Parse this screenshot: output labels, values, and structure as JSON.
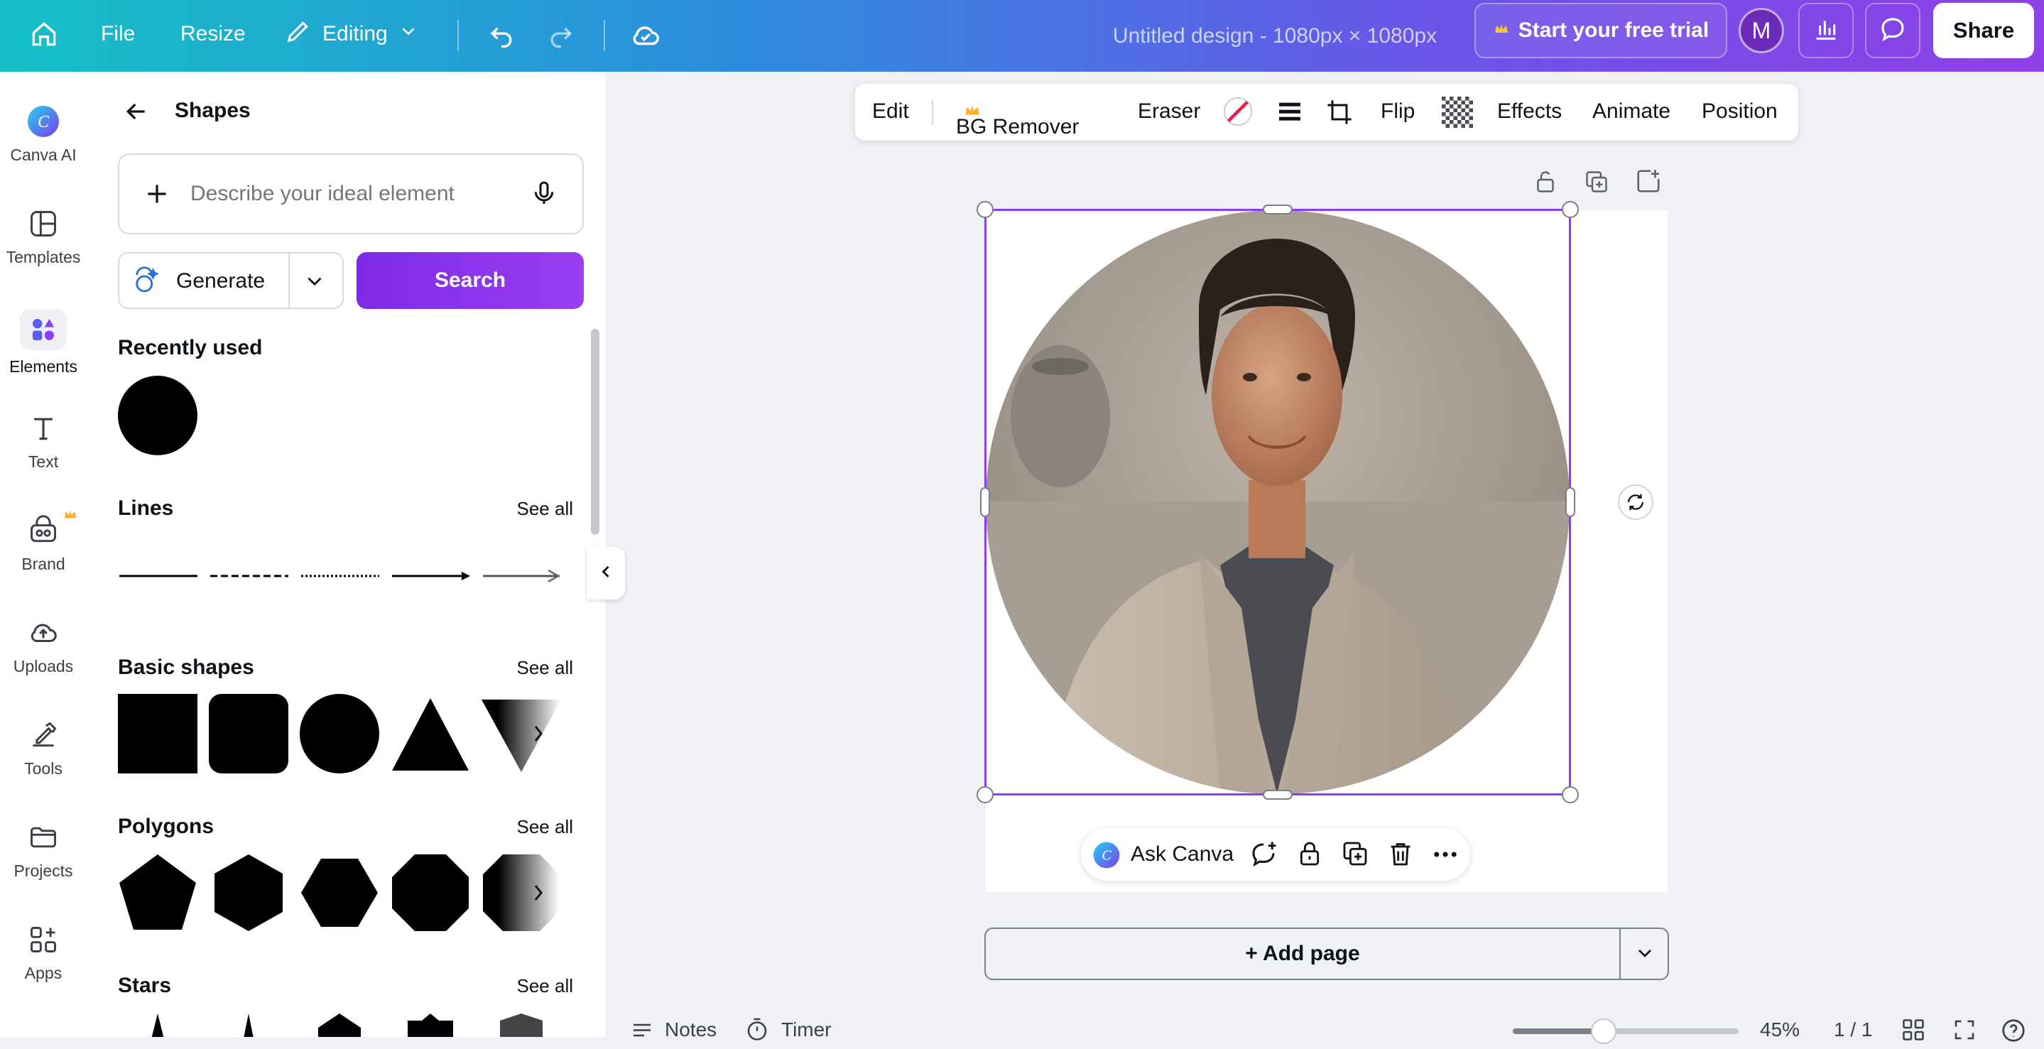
{
  "topbar": {
    "file": "File",
    "resize": "Resize",
    "mode": "Editing",
    "title": "Untitled design - 1080px × 1080px",
    "trial": "Start your free trial",
    "avatar": "M",
    "share": "Share"
  },
  "rail": {
    "items": [
      {
        "label": "Canva AI"
      },
      {
        "label": "Templates"
      },
      {
        "label": "Elements"
      },
      {
        "label": "Text"
      },
      {
        "label": "Brand"
      },
      {
        "label": "Uploads"
      },
      {
        "label": "Tools"
      },
      {
        "label": "Projects"
      },
      {
        "label": "Apps"
      }
    ]
  },
  "panel": {
    "title": "Shapes",
    "search_placeholder": "Describe your ideal element",
    "generate": "Generate",
    "search": "Search",
    "recently_used": "Recently used",
    "lines": "Lines",
    "basic_shapes": "Basic shapes",
    "polygons": "Polygons",
    "stars": "Stars",
    "see_all": "See all"
  },
  "context_toolbar": {
    "edit": "Edit",
    "bg_remover": "BG Remover",
    "eraser": "Eraser",
    "flip": "Flip",
    "effects": "Effects",
    "animate": "Animate",
    "position": "Position"
  },
  "floating_toolbar": {
    "ask": "Ask Canva"
  },
  "canvas": {
    "add_page": "+ Add page"
  },
  "bottom": {
    "notes": "Notes",
    "timer": "Timer",
    "zoom": "45%",
    "pages": "1 / 1"
  },
  "colors": {
    "accent": "#8b3dff",
    "search_button": "#7d2ae8"
  }
}
